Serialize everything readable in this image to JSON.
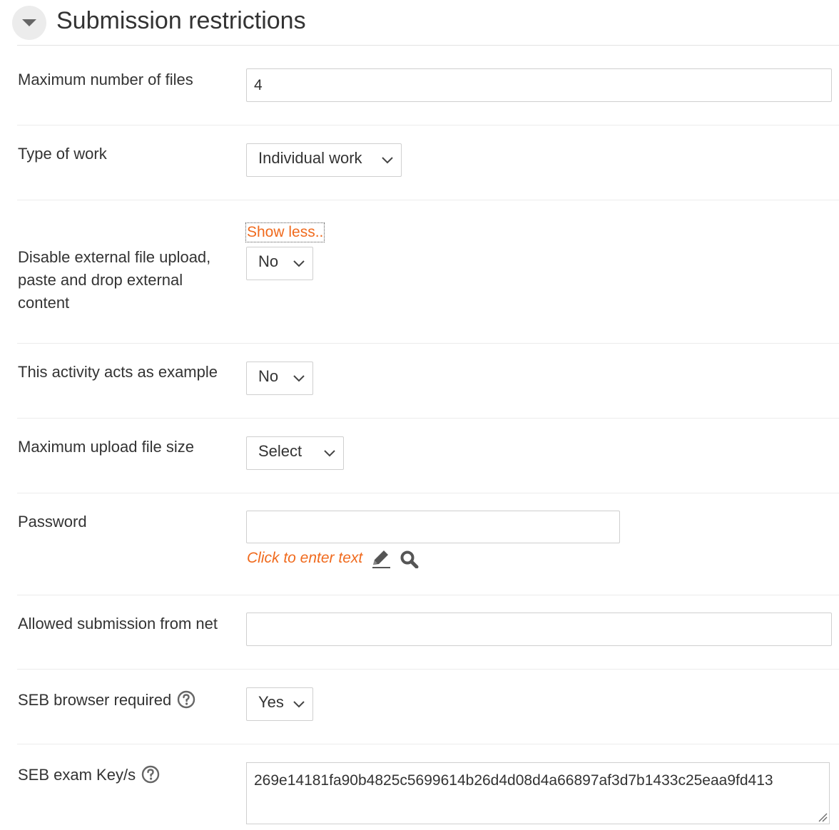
{
  "section": {
    "title": "Submission restrictions"
  },
  "fields": {
    "max_files": {
      "label": "Maximum number of files",
      "value": "4"
    },
    "type_of_work": {
      "label": "Type of work",
      "selected": "Individual work"
    },
    "disable_external": {
      "toggle_link": "Show less..",
      "label": "Disable external file upload, paste and drop external content",
      "selected": "No"
    },
    "acts_as_example": {
      "label": "This activity acts as example",
      "selected": "No"
    },
    "max_upload_size": {
      "label": "Maximum upload file size",
      "selected": "Select"
    },
    "password": {
      "label": "Password",
      "value": "",
      "hint": "Click to enter text"
    },
    "allowed_net": {
      "label": "Allowed submission from net",
      "value": ""
    },
    "seb_required": {
      "label": "SEB browser required",
      "selected": "Yes"
    },
    "seb_keys": {
      "label": "SEB exam Key/s",
      "value": "269e14181fa90b4825c5699614b26d4d08d4a66897af3d7b1433c25eaa9fd413"
    }
  },
  "icons": {
    "collapse": "chevron-down-icon",
    "help": "question-circle-icon",
    "edit": "pencil-icon",
    "search": "magnifier-icon"
  },
  "colors": {
    "accent": "#f06a1d",
    "text": "#333333",
    "border": "#cfcfcf"
  }
}
